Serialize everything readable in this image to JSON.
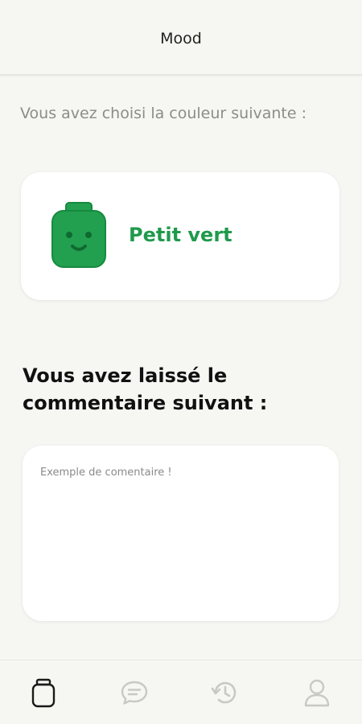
{
  "header": {
    "title": "Mood"
  },
  "intro": {
    "text": "Vous avez choisi la couleur suivante :"
  },
  "mood": {
    "color_name": "Petit vert",
    "color_hex": "#1f9a4c",
    "face_color": "#22a04f",
    "icon": "smiley-face-icon"
  },
  "comment": {
    "title": "Vous avez laissé le commentaire suivant :",
    "text": "Exemple de comentaire !"
  },
  "tabbar": {
    "tabs": [
      {
        "icon": "jar-icon",
        "active": true
      },
      {
        "icon": "chat-bubble-icon",
        "active": false
      },
      {
        "icon": "history-icon",
        "active": false
      },
      {
        "icon": "profile-icon",
        "active": false
      }
    ],
    "active_color": "#1a1a1a",
    "inactive_color": "#c8c8c4"
  }
}
